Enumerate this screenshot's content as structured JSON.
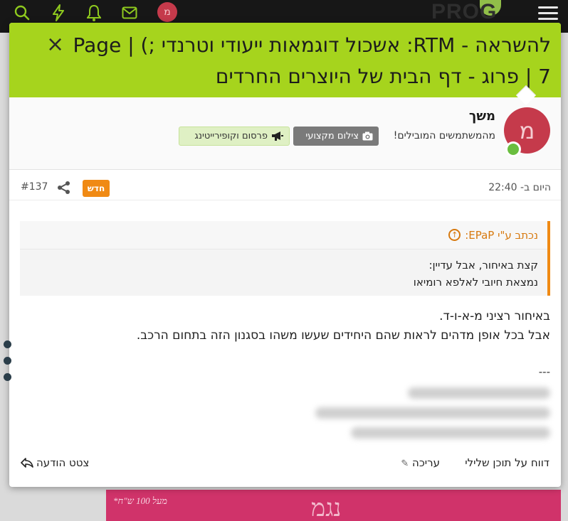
{
  "topbar": {
    "icons": [
      "search-icon",
      "bolt-icon",
      "bell-icon",
      "envelope-icon"
    ],
    "avatar_letter": "מ",
    "logo_text": "PROG",
    "menu_icon": "hamburger-icon",
    "accent": "#8fca1e"
  },
  "modal": {
    "title": "להשראה - RTM: אשכול דוגמאות ייעודי וטרנדי ;) | Page 7 | פרוג - דף הבית של היוצרים החרדים",
    "close_label": "×",
    "header_color": "#a6d41d"
  },
  "user": {
    "avatar_letter": "מ",
    "name": "משך",
    "title": "מהמשתמשים המובילים!",
    "badges": [
      {
        "label": "צילום מקצועי",
        "icon": "camera-icon"
      },
      {
        "label": "פרסום וקופירייטינג",
        "icon": "megaphone-icon"
      }
    ]
  },
  "post": {
    "date": "היום ב- 22:40",
    "new_label": "חדש",
    "number": "#137",
    "quote": {
      "author": "נכתב ע\"י EPaP:",
      "lines": [
        "קצת באיחור, אבל עדיין:",
        "נמצאת חיובי לאלפא רומיאו"
      ]
    },
    "body_lines": [
      "באיחור רציני מ-א-ו-ד.",
      "אבל בכל אופן מדהים לראות שהם היחידים שעשו משהו בסגנון הזה בתחום הרכב."
    ],
    "signature_separator": "---"
  },
  "actions": {
    "report": "דווח על תוכן שלילי",
    "edit": "עריכה",
    "quote": "צטט הודעה"
  },
  "ad": {
    "small_text": "*מעל 100 ש\"ח",
    "big_text": "נגמ",
    "color": "#d0336a"
  }
}
